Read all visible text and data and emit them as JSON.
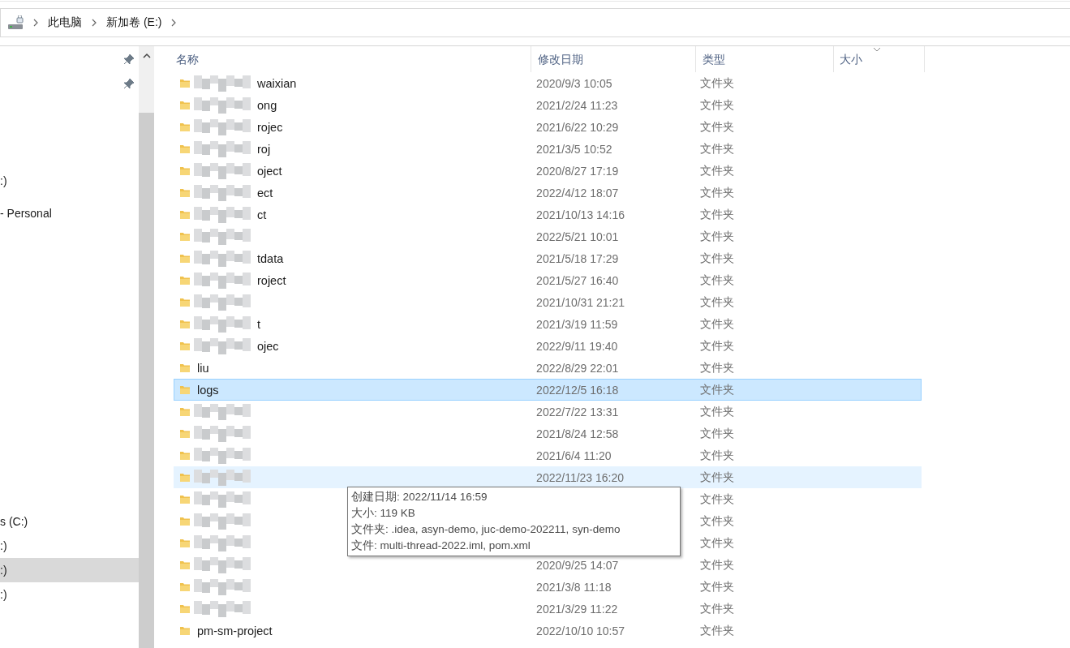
{
  "breadcrumb": {
    "items": [
      "此电脑",
      "新加卷 (E:)"
    ]
  },
  "nav": {
    "items": [
      {
        "label": ":)",
        "selected": false
      },
      {
        "label": "- Personal",
        "selected": false
      },
      {
        "label": "s (C:)",
        "selected": false
      },
      {
        "label": ":)",
        "selected": false
      },
      {
        "label": ":)",
        "selected": true
      },
      {
        "label": ":)",
        "selected": false
      }
    ]
  },
  "table": {
    "columns": [
      "名称",
      "修改日期",
      "类型",
      "大小"
    ],
    "rows": [
      {
        "name": "waixian",
        "redacted": true,
        "date": "2020/9/3 10:05",
        "type": "文件夹",
        "selected": false,
        "hovered": false
      },
      {
        "name": "ong",
        "redacted": true,
        "date": "2021/2/24 11:23",
        "type": "文件夹",
        "selected": false,
        "hovered": false
      },
      {
        "name": "rojec",
        "redacted": true,
        "date": "2021/6/22 10:29",
        "type": "文件夹",
        "selected": false,
        "hovered": false
      },
      {
        "name": "roj",
        "redacted": true,
        "date": "2021/3/5 10:52",
        "type": "文件夹",
        "selected": false,
        "hovered": false
      },
      {
        "name": "oject",
        "redacted": true,
        "date": "2020/8/27 17:19",
        "type": "文件夹",
        "selected": false,
        "hovered": false
      },
      {
        "name": "ect",
        "redacted": true,
        "date": "2022/4/12 18:07",
        "type": "文件夹",
        "selected": false,
        "hovered": false
      },
      {
        "name": "ct",
        "redacted": true,
        "date": "2021/10/13 14:16",
        "type": "文件夹",
        "selected": false,
        "hovered": false
      },
      {
        "redacted": true,
        "date": "2022/5/21 10:01",
        "type": "文件夹",
        "selected": false,
        "hovered": false
      },
      {
        "name": "tdata",
        "redacted": true,
        "date": "2021/5/18 17:29",
        "type": "文件夹",
        "selected": false,
        "hovered": false
      },
      {
        "name": "roject",
        "redacted": true,
        "date": "2021/5/27 16:40",
        "type": "文件夹",
        "selected": false,
        "hovered": false
      },
      {
        "redacted": true,
        "date": "2021/10/31 21:21",
        "type": "文件夹",
        "selected": false,
        "hovered": false
      },
      {
        "name": "t",
        "redacted": true,
        "date": "2021/3/19 11:59",
        "type": "文件夹",
        "selected": false,
        "hovered": false
      },
      {
        "name": "ojec",
        "redacted": true,
        "date": "2022/9/11 19:40",
        "type": "文件夹",
        "selected": false,
        "hovered": false
      },
      {
        "name": "liu",
        "redacted": false,
        "date": "2022/8/29 22:01",
        "type": "文件夹",
        "selected": false,
        "hovered": false
      },
      {
        "name": "logs",
        "redacted": false,
        "date": "2022/12/5 16:18",
        "type": "文件夹",
        "selected": true,
        "hovered": false
      },
      {
        "redacted": true,
        "date": "2022/7/22 13:31",
        "type": "文件夹",
        "selected": false,
        "hovered": false
      },
      {
        "redacted": true,
        "date": "2021/8/24 12:58",
        "type": "文件夹",
        "selected": false,
        "hovered": false
      },
      {
        "redacted": true,
        "date": "2021/6/4 11:20",
        "type": "文件夹",
        "selected": false,
        "hovered": false
      },
      {
        "redacted": true,
        "date": "2022/11/23 16:20",
        "type": "文件夹",
        "selected": false,
        "hovered": true
      },
      {
        "redacted": true,
        "type": "文件夹",
        "selected": false,
        "hovered": false
      },
      {
        "redacted": true,
        "type": "文件夹",
        "selected": false,
        "hovered": false
      },
      {
        "redacted": true,
        "type": "文件夹",
        "selected": false,
        "hovered": false
      },
      {
        "redacted": true,
        "date": "2020/9/25 14:07",
        "type": "文件夹",
        "selected": false,
        "hovered": false
      },
      {
        "redacted": true,
        "date": "2021/3/8 11:18",
        "type": "文件夹",
        "selected": false,
        "hovered": false
      },
      {
        "redacted": true,
        "date": "2021/3/29 11:22",
        "type": "文件夹",
        "selected": false,
        "hovered": false
      },
      {
        "name": "pm-sm-project",
        "redacted": false,
        "date": "2022/10/10 10:57",
        "type": "文件夹",
        "selected": false,
        "hovered": false
      }
    ]
  },
  "tooltip": {
    "lines": [
      "创建日期: 2022/11/14 16:59",
      "大小: 119 KB",
      "文件夹: .idea, asyn-demo, juc-demo-202211, syn-demo",
      "文件: multi-thread-2022.iml, pom.xml"
    ]
  }
}
